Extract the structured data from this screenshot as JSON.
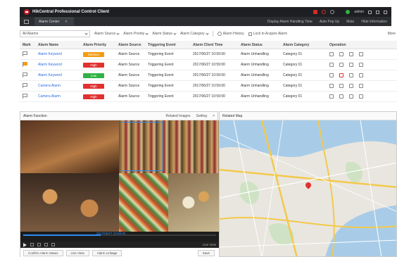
{
  "app": {
    "title": "HikCentral Professional Control Client",
    "user": "admin",
    "notice_count": ""
  },
  "nav": {
    "tab_label": "Alarm Center",
    "right_items": [
      "Display Alarm Handling Time",
      "Auto Pop Up",
      "Mute",
      "Hide Information"
    ]
  },
  "filters": {
    "scope": "All Alarms",
    "items": [
      "Alarm Source",
      "Alarm Priority",
      "Alarm Status",
      "Alarm Category"
    ],
    "alarm_history": "Alarm History",
    "lock": "Lock to Acquire Alarm",
    "more": "More"
  },
  "table": {
    "headers": [
      "Mark",
      "Alarm Name",
      "Alarm Priority",
      "Alarm Source",
      "Triggering Event",
      "Alarm Client Time",
      "Alarm Status",
      "Alarm Category",
      "Operation"
    ],
    "rows": [
      {
        "name": "Alarm Keyword",
        "priority": "Medium",
        "priority_color": "#f39c12",
        "source": "Alarm Source",
        "event": "Triggering Event",
        "time": "2017/06/27 10:59:00",
        "status": "Alarm Unhandling",
        "category": "Category 01",
        "flagged": false
      },
      {
        "name": "Alarm Keyword",
        "priority": "High",
        "priority_color": "#e03131",
        "source": "Alarm Source",
        "event": "Triggering Event",
        "time": "2017/06/27 10:59:00",
        "status": "Alarm Unhandling",
        "category": "Category 01",
        "flagged": true
      },
      {
        "name": "Alarm Keyword",
        "priority": "Low",
        "priority_color": "#2fb344",
        "source": "Alarm Source",
        "event": "Triggering Event",
        "time": "2017/06/27 10:59:00",
        "status": "Alarm Unhandling",
        "category": "Category 01",
        "flagged": false
      },
      {
        "name": "Camera Alarm",
        "priority": "High",
        "priority_color": "#e03131",
        "source": "Alarm Source",
        "event": "Triggering Event",
        "time": "2017/06/27 10:59:00",
        "status": "Alarm Unhandling",
        "category": "Category 01",
        "flagged": false
      },
      {
        "name": "Camera Alarm",
        "priority": "High",
        "priority_color": "#e03131",
        "source": "Alarm Source",
        "event": "Triggering Event",
        "time": "2017/06/27 10:59:00",
        "status": "Alarm Unhandling",
        "category": "Category 01",
        "flagged": false
      }
    ]
  },
  "alarm_function": {
    "title": "Alarm Function",
    "tools": [
      "Related Images",
      "Setting"
    ],
    "timeline_label": "2017/06/27 10:59:00",
    "control_right": "Live View",
    "buttons": [
      "Confirm Alarm Status",
      "Live View",
      "Alarm Linkage"
    ],
    "right_button": "Save"
  },
  "related_map": {
    "title": "Related Map"
  },
  "colors": {
    "accent": "#2d6cdf",
    "titlebar": "#1e1f22",
    "navbar": "#2b2d31"
  }
}
